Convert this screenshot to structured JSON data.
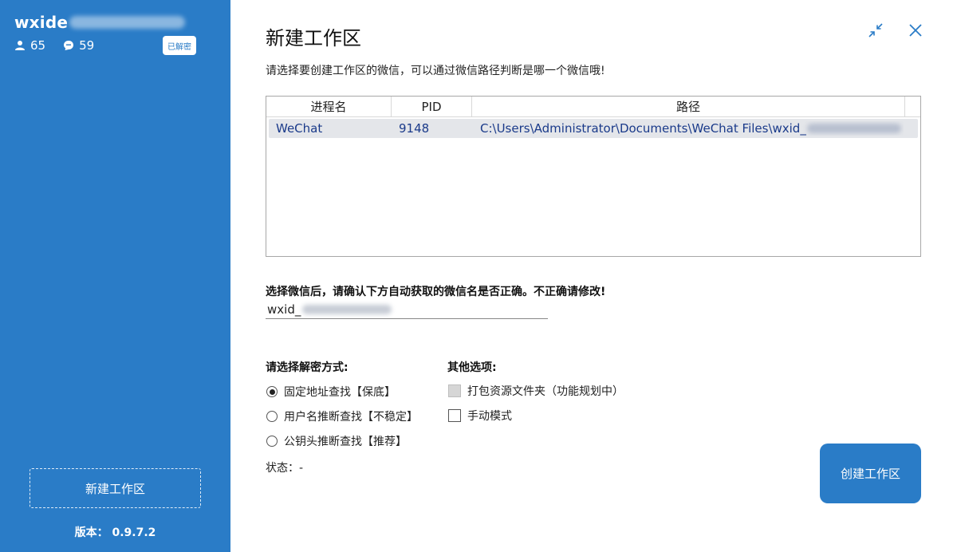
{
  "sidebar": {
    "account_name": "wxide",
    "contacts_count": "65",
    "chats_count": "59",
    "badge": "已解密",
    "new_workspace": "新建工作区",
    "version": "版本：  0.9.7.2"
  },
  "dialog": {
    "title": "新建工作区",
    "subtitle": "请选择要创建工作区的微信，可以通过微信路径判断是哪一个微信哦!",
    "table": {
      "headers": [
        "进程名",
        "PID",
        "路径"
      ],
      "rows": [
        {
          "name": "WeChat",
          "pid": "9148",
          "path": "C:\\Users\\Administrator\\Documents\\WeChat Files\\wxid_"
        }
      ]
    },
    "confirm_label": "选择微信后，请确认下方自动获取的微信名是否正确。不正确请修改!",
    "wxid_value": "wxid_",
    "decrypt": {
      "label": "请选择解密方式:",
      "options": [
        "固定地址查找【保底】",
        "用户名推断查找【不稳定】",
        "公钥头推断查找【推荐】"
      ],
      "selected_index": 0
    },
    "other": {
      "label": "其他选项:",
      "options": [
        "打包资源文件夹（功能规划中）",
        "手动模式"
      ]
    },
    "status_label": "状态：",
    "status_value": "-",
    "create_button": "创建工作区"
  }
}
